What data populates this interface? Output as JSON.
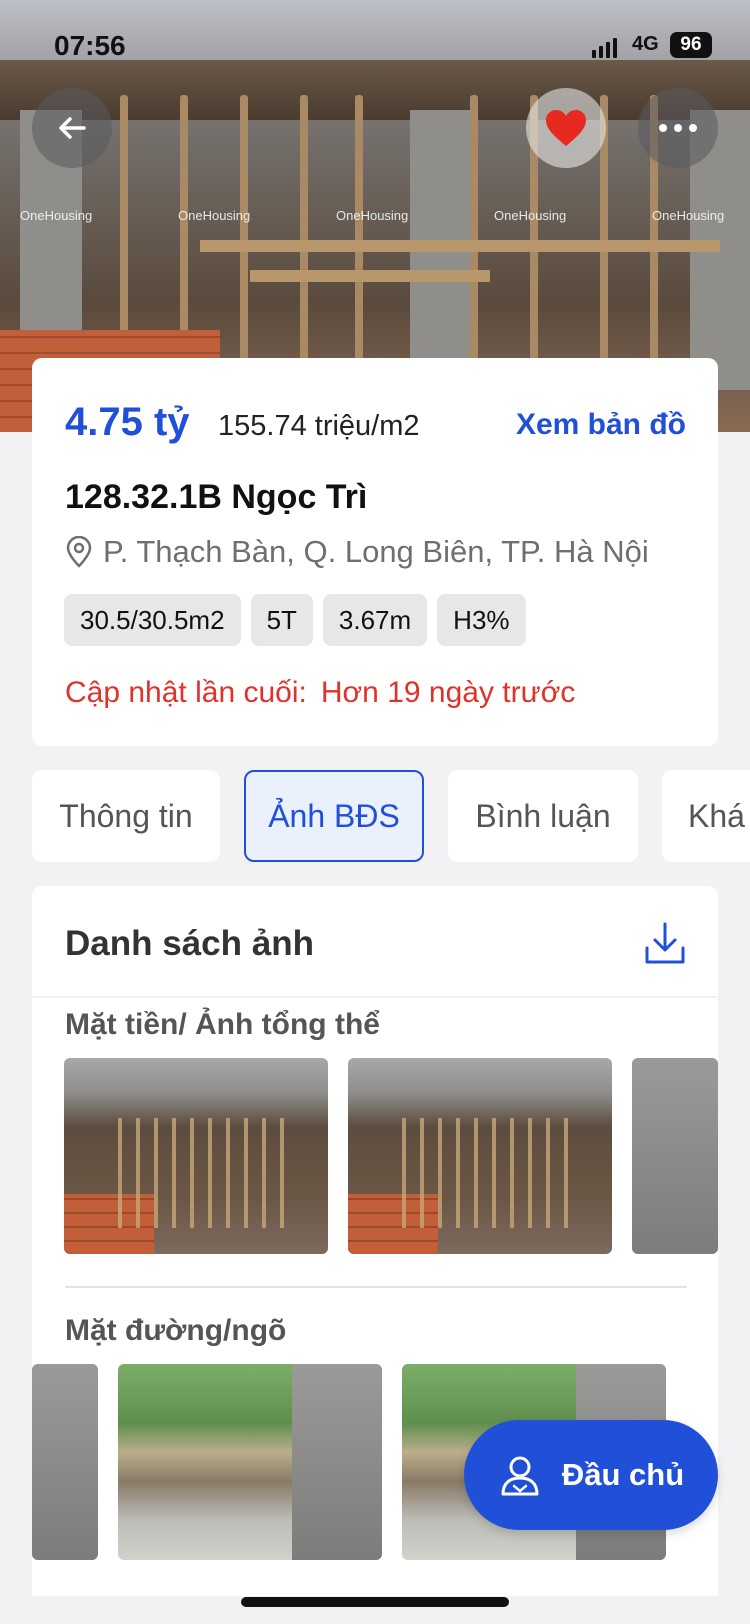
{
  "status_bar": {
    "time": "07:56",
    "network": "4G",
    "battery": "96"
  },
  "hero": {
    "watermark": "OneHousing"
  },
  "listing": {
    "price": "4.75 tỷ",
    "unit_price": "155.74 triệu/m2",
    "map_link": "Xem bản đồ",
    "address": "128.32.1B Ngọc Trì",
    "location": "P. Thạch Bàn, Q. Long Biên, TP. Hà Nội",
    "tags": [
      "30.5/30.5m2",
      "5T",
      "3.67m",
      "H3%"
    ],
    "updated_label": "Cập nhật lần cuối:",
    "updated_value": "Hơn 19 ngày trước"
  },
  "tabs": [
    "Thông tin",
    "Ảnh BĐS",
    "Bình luận",
    "Khá"
  ],
  "photos": {
    "title": "Danh sách ảnh",
    "groups": [
      "Mặt tiền/ Ảnh tổng thể",
      "Mặt đường/ngõ"
    ]
  },
  "owner_button": {
    "label": "Đầu chủ"
  },
  "colors": {
    "accent": "#2150d8",
    "alert": "#e0322b"
  }
}
